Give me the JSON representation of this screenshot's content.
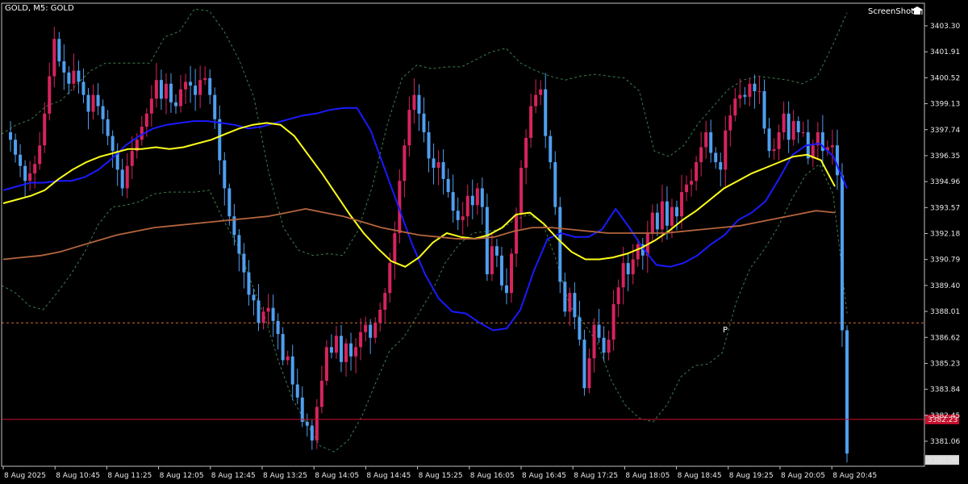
{
  "header": {
    "symbol_label": "GOLD, M5:  GOLD"
  },
  "brand": {
    "label": "ScreenShot",
    "icon": "graduation-cap-icon"
  },
  "colors": {
    "background": "#000000",
    "bull": "#d6245d",
    "bear": "#4f9fef",
    "ma_fast": "#1a1aff",
    "ma_mid": "#ffff1a",
    "ma_slow": "#b5653d",
    "bands": "#3c7d4e",
    "grid": "#1f1f1f",
    "price_line": "#c8102e",
    "pivot_line": "#d26b2f"
  },
  "chart_data": {
    "type": "candlestick",
    "title": "GOLD, M5:  GOLD",
    "timeframe": "M5",
    "ylim": [
      3380.06,
      3404.2
    ],
    "y_ticks": [
      3403.3,
      3401.91,
      3400.52,
      3399.13,
      3397.74,
      3396.35,
      3394.96,
      3393.57,
      3392.18,
      3390.79,
      3389.4,
      3388.01,
      3386.62,
      3385.23,
      3383.84,
      3382.45,
      3381.06
    ],
    "y_tick_labels": [
      "3403.30",
      "3401.91",
      "3400.52",
      "3399.13",
      "3397.74",
      "3396.35",
      "3394.96",
      "3393.57",
      "3392.18",
      "3390.79",
      "3389.40",
      "3388.01",
      "3386.62",
      "3385.23",
      "3383.84",
      "3382.45",
      "3381.06"
    ],
    "x_tick_labels": [
      "8 Aug 2025",
      "8 Aug 10:45",
      "8 Aug 11:25",
      "8 Aug 12:05",
      "8 Aug 12:45",
      "8 Aug 13:25",
      "8 Aug 14:05",
      "8 Aug 14:45",
      "8 Aug 15:25",
      "8 Aug 16:05",
      "8 Aug 16:45",
      "8 Aug 17:25",
      "8 Aug 18:05",
      "8 Aug 18:45",
      "8 Aug 19:25",
      "8 Aug 20:05",
      "8 Aug 20:45"
    ],
    "current_price": 3382.23,
    "current_price_label": "3382.23",
    "last_label": "3380.06",
    "pivot": {
      "label": "P",
      "value": 3387.4
    },
    "close_path": [
      3397.6,
      3397.2,
      3396.4,
      3395.8,
      3395.0,
      3395.4,
      3395.9,
      3396.9,
      3398.6,
      3400.6,
      3402.6,
      3401.4,
      3400.8,
      3400.2,
      3400.9,
      3400.3,
      3399.6,
      3398.7,
      3399.6,
      3399.0,
      3398.3,
      3397.4,
      3396.6,
      3395.6,
      3394.6,
      3395.8,
      3396.6,
      3397.2,
      3397.9,
      3398.6,
      3399.4,
      3400.4,
      3399.4,
      3400.2,
      3399.2,
      3399.0,
      3399.9,
      3400.3,
      3400.1,
      3399.6,
      3400.4,
      3400.5,
      3399.6,
      3398.3,
      3396.1,
      3394.6,
      3393.1,
      3392.1,
      3391.1,
      3390.1,
      3388.9,
      3388.6,
      3387.4,
      3388.0,
      3388.2,
      3387.5,
      3386.8,
      3385.4,
      3385.6,
      3384.1,
      3383.4,
      3382.1,
      3381.9,
      3381.1,
      3382.9,
      3384.3,
      3386.1,
      3385.8,
      3386.7,
      3385.3,
      3386.3,
      3385.6,
      3386.1,
      3386.9,
      3387.3,
      3386.6,
      3387.4,
      3388.1,
      3389.0,
      3390.6,
      3392.2,
      3395.0,
      3396.9,
      3398.8,
      3399.6,
      3398.6,
      3397.6,
      3396.2,
      3395.7,
      3396.0,
      3395.1,
      3394.4,
      3393.4,
      3392.9,
      3393.1,
      3394.2,
      3393.7,
      3394.6,
      3393.6,
      3390.0,
      3391.5,
      3391.0,
      3389.4,
      3389.0,
      3391.1,
      3393.2,
      3395.7,
      3397.3,
      3399.0,
      3399.6,
      3399.9,
      3397.4,
      3396.0,
      3393.6,
      3389.6,
      3388.0,
      3389.0,
      3387.7,
      3386.5,
      3383.9,
      3385.5,
      3387.3,
      3386.6,
      3385.8,
      3386.5,
      3388.4,
      3389.3,
      3390.6,
      3390.0,
      3390.8,
      3391.6,
      3391.0,
      3392.2,
      3393.3,
      3392.4,
      3393.9,
      3392.6,
      3393.6,
      3393.1,
      3394.4,
      3394.8,
      3395.0,
      3396.0,
      3396.8,
      3397.6,
      3396.5,
      3396.0,
      3395.6,
      3397.7,
      3398.5,
      3399.4,
      3399.6,
      3399.5,
      3400.2,
      3399.8,
      3399.8,
      3397.8,
      3396.6,
      3396.7,
      3397.6,
      3398.6,
      3397.2,
      3398.2,
      3397.6,
      3397.6,
      3396.2,
      3396.9,
      3397.6,
      3396.6,
      3396.8,
      3396.9,
      3395.3,
      3387.0,
      3380.4
    ],
    "series": [
      {
        "name": "MA fast",
        "values": [
          3394.5,
          3394.7,
          3394.9,
          3394.9,
          3395.0,
          3395.0,
          3395.2,
          3395.6,
          3396.2,
          3396.9,
          3397.4,
          3397.8,
          3398.0,
          3398.1,
          3398.2,
          3398.2,
          3398.1,
          3398.0,
          3397.8,
          3397.9,
          3398.1,
          3398.3,
          3398.5,
          3398.6,
          3398.8,
          3398.9,
          3398.9,
          3397.7,
          3395.7,
          3393.7,
          3391.7,
          3390.0,
          3388.7,
          3388.0,
          3387.9,
          3387.4,
          3387.0,
          3387.1,
          3388.1,
          3390.2,
          3391.9,
          3392.2,
          3392.0,
          3392.0,
          3392.4,
          3393.5,
          3392.5,
          3391.4,
          3390.5,
          3390.4,
          3390.6,
          3391.0,
          3391.6,
          3392.1,
          3392.9,
          3393.3,
          3393.9,
          3395.1,
          3396.4,
          3396.9,
          3397.0,
          3396.3,
          3394.6
        ]
      },
      {
        "name": "MA mid",
        "values": [
          3393.8,
          3394.0,
          3394.2,
          3394.5,
          3395.1,
          3395.6,
          3396.0,
          3396.3,
          3396.5,
          3396.7,
          3396.7,
          3396.8,
          3396.7,
          3396.8,
          3397.0,
          3397.2,
          3397.5,
          3397.8,
          3398.0,
          3398.1,
          3398.0,
          3397.4,
          3396.4,
          3395.4,
          3394.3,
          3393.2,
          3392.2,
          3391.4,
          3390.7,
          3390.4,
          3390.9,
          3391.7,
          3392.2,
          3392.0,
          3391.9,
          3392.1,
          3392.5,
          3393.2,
          3393.3,
          3392.7,
          3391.9,
          3391.2,
          3390.8,
          3390.8,
          3390.9,
          3391.1,
          3391.4,
          3391.8,
          3392.3,
          3392.9,
          3393.4,
          3394.0,
          3394.6,
          3395.0,
          3395.4,
          3395.7,
          3396.0,
          3396.3,
          3396.4,
          3396.1,
          3394.7
        ]
      },
      {
        "name": "MA slow",
        "values": [
          3390.8,
          3390.9,
          3391.0,
          3391.2,
          3391.5,
          3391.8,
          3392.1,
          3392.3,
          3392.5,
          3392.6,
          3392.7,
          3392.8,
          3392.9,
          3393.0,
          3393.1,
          3393.3,
          3393.5,
          3393.3,
          3393.1,
          3392.8,
          3392.5,
          3392.3,
          3392.1,
          3392.0,
          3391.9,
          3391.9,
          3392.0,
          3392.3,
          3392.5,
          3392.5,
          3392.4,
          3392.3,
          3392.2,
          3392.2,
          3392.2,
          3392.2,
          3392.3,
          3392.4,
          3392.5,
          3392.6,
          3392.8,
          3393.0,
          3393.2,
          3393.4,
          3393.3
        ]
      },
      {
        "name": "Band upper",
        "values": [
          3397.5,
          3398.0,
          3398.3,
          3399.0,
          3399.3,
          3400.1,
          3400.9,
          3401.3,
          3401.3,
          3401.3,
          3401.3,
          3402.7,
          3403.0,
          3404.2,
          3404.1,
          3403.0,
          3401.5,
          3399.5,
          3395.5,
          3392.5,
          3391.3,
          3391.0,
          3391.1,
          3391.0,
          3392.3,
          3394.7,
          3398.0,
          3400.5,
          3401.2,
          3401.0,
          3401.1,
          3401.1,
          3401.5,
          3401.9,
          3402.1,
          3401.3,
          3400.9,
          3400.6,
          3400.4,
          3400.6,
          3400.7,
          3400.6,
          3400.5,
          3399.8,
          3396.6,
          3396.3,
          3396.9,
          3398.1,
          3399.0,
          3399.9,
          3400.4,
          3400.6,
          3400.5,
          3400.4,
          3400.2,
          3400.6,
          3402.2,
          3404.0
        ]
      },
      {
        "name": "Band lower",
        "values": [
          3389.4,
          3389.0,
          3388.3,
          3388.1,
          3389.0,
          3390.0,
          3391.2,
          3392.7,
          3393.6,
          3393.7,
          3393.9,
          3394.3,
          3394.4,
          3394.4,
          3394.4,
          3394.5,
          3392.9,
          3391.6,
          3389.6,
          3387.7,
          3385.3,
          3383.3,
          3382.0,
          3380.8,
          3380.5,
          3381.1,
          3382.4,
          3384.2,
          3385.9,
          3386.6,
          3387.8,
          3389.0,
          3390.6,
          3391.6,
          3392.2,
          3392.3,
          3392.4,
          3392.9,
          3393.2,
          3392.8,
          3390.8,
          3388.3,
          3387.4,
          3386.3,
          3384.3,
          3383.0,
          3382.3,
          3382.1,
          3383.0,
          3384.5,
          3385.1,
          3385.2,
          3385.8,
          3388.5,
          3390.3,
          3391.3,
          3392.5,
          3394.0,
          3395.3,
          3395.9,
          3394.3,
          3387.9
        ]
      }
    ]
  }
}
